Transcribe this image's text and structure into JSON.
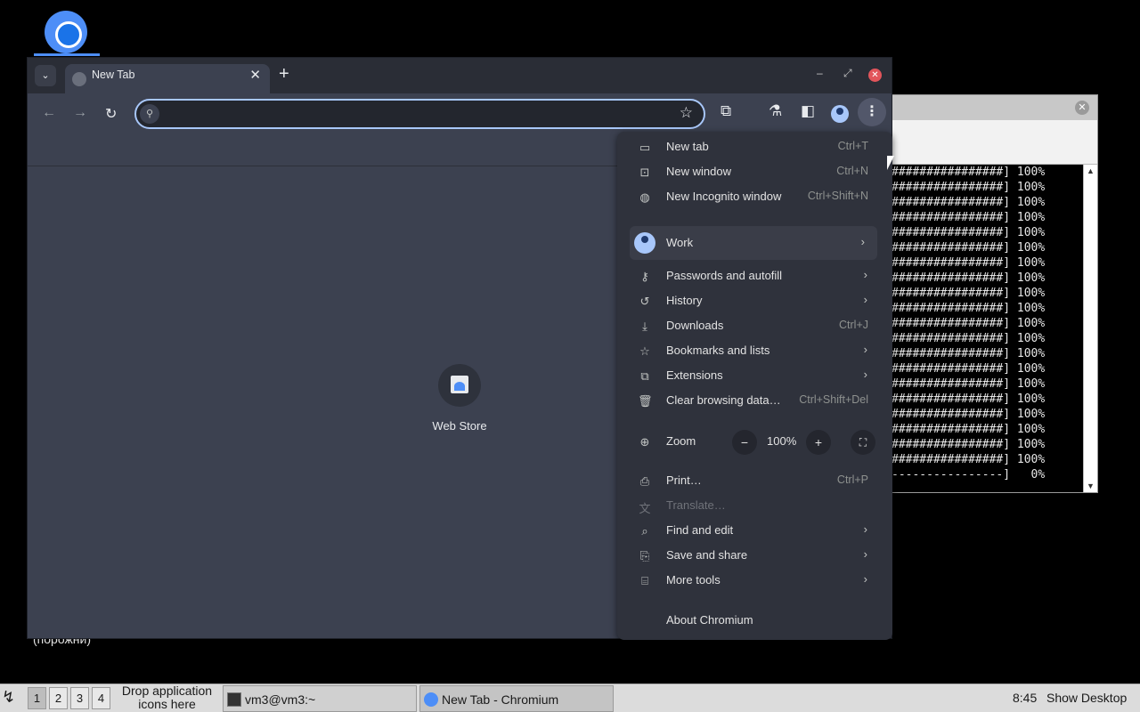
{
  "desktop": {
    "label": "(порожни)"
  },
  "terminal": {
    "lines": [
      "################] 100%",
      "################] 100%",
      "################] 100%",
      "################] 100%",
      "################] 100%",
      "################] 100%",
      "################] 100%",
      "################] 100%",
      "################] 100%",
      "################] 100%",
      "################] 100%",
      "################] 100%",
      "################] 100%",
      "################] 100%",
      "################] 100%",
      "################] 100%",
      "################] 100%",
      "################] 100%",
      "################] 100%",
      "################] 100%",
      "----------------]   0%"
    ]
  },
  "browser": {
    "tab_title": "New Tab",
    "omnibox_value": "",
    "shortcut_label": "Web Store"
  },
  "menu": {
    "items": [
      {
        "label": "New tab",
        "shortcut": "Ctrl+T",
        "icon": "new-tab-icon"
      },
      {
        "label": "New window",
        "shortcut": "Ctrl+N",
        "icon": "new-window-icon"
      },
      {
        "label": "New Incognito window",
        "shortcut": "Ctrl+Shift+N",
        "icon": "incognito-icon"
      },
      {
        "label": "Work",
        "icon": "profile-avatar-icon"
      },
      {
        "label": "Passwords and autofill",
        "icon": "key-icon"
      },
      {
        "label": "History",
        "icon": "history-icon"
      },
      {
        "label": "Downloads",
        "shortcut": "Ctrl+J",
        "icon": "download-icon"
      },
      {
        "label": "Bookmarks and lists",
        "icon": "star-icon"
      },
      {
        "label": "Extensions",
        "icon": "puzzle-icon"
      },
      {
        "label": "Clear browsing data…",
        "shortcut": "Ctrl+Shift+Del",
        "icon": "trash-icon"
      },
      {
        "label": "Zoom",
        "icon": "zoom-icon"
      },
      {
        "label": "Print…",
        "shortcut": "Ctrl+P",
        "icon": "print-icon"
      },
      {
        "label": "Translate…",
        "icon": "translate-icon",
        "disabled": true
      },
      {
        "label": "Find and edit",
        "icon": "find-icon"
      },
      {
        "label": "Save and share",
        "icon": "save-icon"
      },
      {
        "label": "More tools",
        "icon": "toolbox-icon"
      },
      {
        "label": "About Chromium"
      }
    ],
    "zoom_value": "100%",
    "zoom_minus": "−",
    "zoom_plus": "+"
  },
  "taskbar": {
    "workspaces": [
      "1",
      "2",
      "3",
      "4"
    ],
    "drop_text": "Drop application icons here",
    "tasks": [
      {
        "label": "vm3@vm3:~",
        "icon": "terminal-icon"
      },
      {
        "label": "New Tab - Chromium",
        "icon": "chromium-icon"
      }
    ],
    "clock": "8:45",
    "show_desktop": "Show Desktop"
  },
  "colors": {
    "browser_bg": "#3c4150",
    "menu_bg": "#2f323c",
    "accent": "#a8c7fa",
    "close_red": "#e2555b"
  }
}
